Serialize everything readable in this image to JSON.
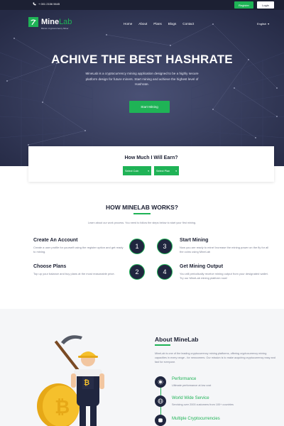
{
  "topbar": {
    "phone": "+ 001 2156 5645",
    "register_label": "Register",
    "login_label": "Login"
  },
  "header": {
    "logo_main": "Mine",
    "logo_accent": "Lab",
    "logo_tagline": "Bitcoin Cryptocurrency Miner",
    "nav": [
      "Home",
      "About",
      "Plans",
      "Blogs",
      "Contact"
    ],
    "language": "English"
  },
  "hero": {
    "title": "ACHIVE THE BEST HASHRATE",
    "description": "MineLab is a cryptocurrency mining application designed to be a highly secure platform design for future miners. Start mining and achieve the highest level of Hashrate.",
    "cta_label": "Start Mining"
  },
  "earnings": {
    "title": "How Much I Will Earn?",
    "coin_select": "Select Coin",
    "plan_select": "Select Plan"
  },
  "how": {
    "title": "HOW MINELAB WORKS?",
    "subtitle": "Learn about our work process. You need to follow the steps below to start your first mining.",
    "steps": [
      {
        "num": "1",
        "title": "Create An Account",
        "text": "Create a user profile for yourself using the register option and get ready to mining."
      },
      {
        "num": "2",
        "title": "Choose Plans",
        "text": "Top up your balance and buy plans at the most reasonable price."
      },
      {
        "num": "3",
        "title": "Start Mining",
        "text": "Now you are ready to mine! Increase the mining power on the fly for all the coins using MineLab"
      },
      {
        "num": "4",
        "title": "Get Mining Output",
        "text": "You will periodically receive mining output from your designated wallet. Try our MineLab mining platform now!"
      }
    ]
  },
  "about": {
    "title": "About MineLab",
    "text": "MineLab is one of the leading cryptocurrency mining platforms, offering cryptocurrency mining capacities in every range - for newcomers. Our mission is to make acquiring cryptocurrency easy and fast for everyone.",
    "features": [
      {
        "title": "Performance",
        "desc": "Ultimate performance at low cost"
      },
      {
        "title": "World Wide Service",
        "desc": "Servicing over 2000 customers from 100+ countries"
      },
      {
        "title": "Multiple Cryptocurrencies",
        "desc": ""
      }
    ]
  },
  "colors": {
    "accent": "#1fb356",
    "dark": "#1c2033",
    "hero": "#2b3050"
  }
}
